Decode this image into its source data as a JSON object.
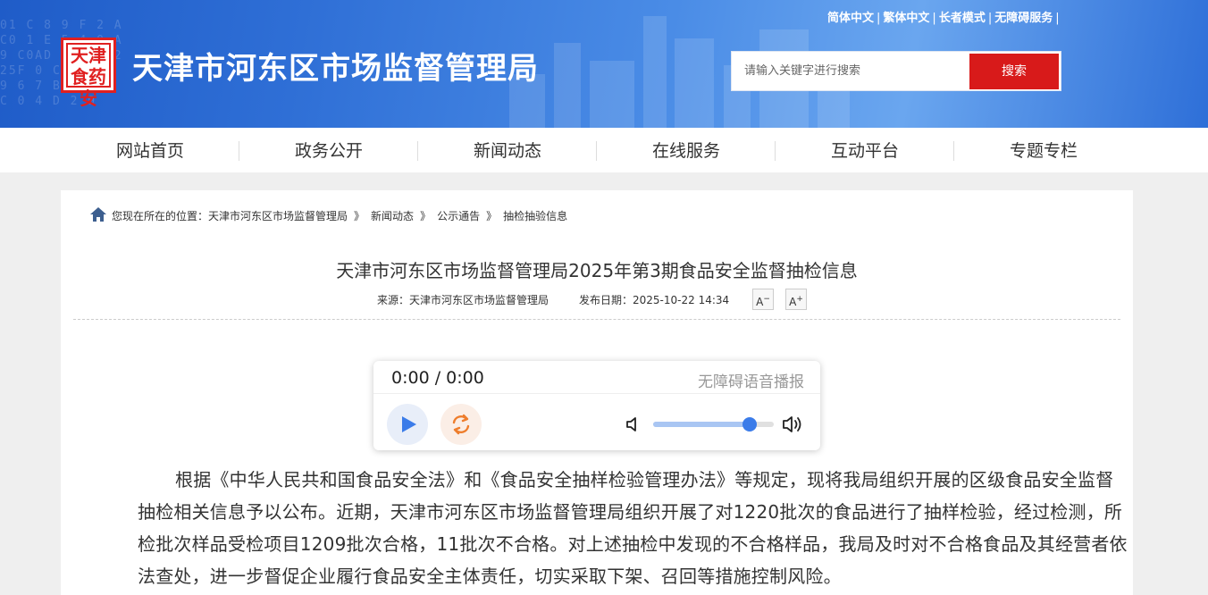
{
  "header": {
    "site_title": "天津市河东区市场监督管理局",
    "logo_text": "天津食药安",
    "top_links": [
      "简体中文",
      "繁体中文",
      "长者模式",
      "无障碍服务"
    ],
    "link_separator": "|",
    "search": {
      "placeholder": "请输入关键字进行搜索",
      "button_label": "搜索"
    },
    "colors": {
      "banner": "#2f6fd6",
      "search_button": "#d81a1a"
    }
  },
  "nav": {
    "items": [
      "网站首页",
      "政务公开",
      "新闻动态",
      "在线服务",
      "互动平台",
      "专题专栏"
    ]
  },
  "breadcrumb": {
    "prefix": "您现在所在的位置：",
    "items": [
      "天津市河东区市场监督管理局",
      "新闻动态",
      "公示通告",
      "抽检抽验信息"
    ],
    "separator": "》"
  },
  "article": {
    "title": "天津市河东区市场监督管理局2025年第3期食品安全监督抽检信息",
    "source": "来源：天津市河东区市场监督管理局",
    "date": "发布日期：2025-10-22 14:34",
    "font_smaller": "A",
    "font_smaller_mark": "−",
    "font_larger": "A",
    "font_larger_mark": "+",
    "body": "根据《中华人民共和国食品安全法》和《食品安全抽样检验管理办法》等规定，现将我局组织开展的区级食品安全监督抽检相关信息予以公布。近期，天津市河东区市场监督管理局组织开展了对1220批次的食品进行了抽样检验，经过检测，所检批次样品受检项目1209批次合格，11批次不合格。对上述抽检中发现的不合格样品，我局及时对不合格食品及其经营者依法查处，进一步督促企业履行食品安全主体责任，切实采取下架、召回等措施控制风险。"
  },
  "player": {
    "time": "0:00 / 0:00",
    "label": "无障碍语音播报",
    "volume": 0.8,
    "icons": [
      "play-icon",
      "loop-icon",
      "volume-low-icon",
      "volume-high-icon"
    ]
  }
}
